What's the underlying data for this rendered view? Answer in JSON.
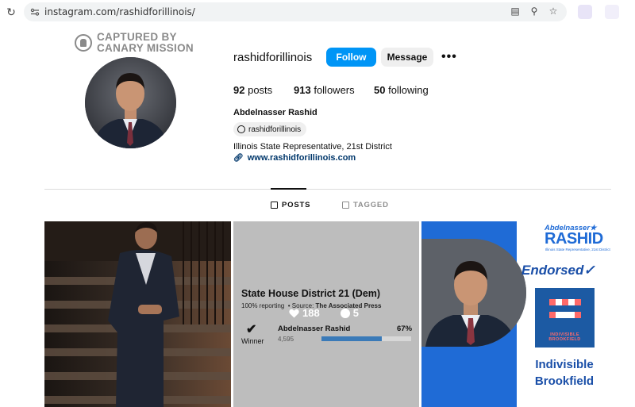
{
  "browser": {
    "url": "instagram.com/rashidforillinois/"
  },
  "watermark": {
    "line1": "CAPTURED BY",
    "line2": "CANARY MISSION"
  },
  "profile": {
    "username": "rashidforillinois",
    "follow_label": "Follow",
    "message_label": "Message",
    "more_label": "•••",
    "stats": {
      "posts_count": "92",
      "posts_label": "posts",
      "followers_count": "913",
      "followers_label": "followers",
      "following_count": "50",
      "following_label": "following"
    },
    "full_name": "Abdelnasser Rashid",
    "threads_handle": "rashidforillinois",
    "bio": "Illinois State Representative, 21st District",
    "website": "www.rashidforillinois.com"
  },
  "tabs": [
    {
      "label": "POSTS",
      "active": true
    },
    {
      "label": "TAGGED",
      "active": false
    }
  ],
  "posts": {
    "post2": {
      "title": "State House District 21 (Dem)",
      "reporting": "100% reporting",
      "source_label": "Source:",
      "source": "The Associated Press",
      "likes": "188",
      "comments": "5",
      "winner_label": "Winner",
      "candidate": "Abdelnasser Rashid",
      "votes": "4,595",
      "percent": "67%",
      "percent_value": 0.67,
      "bar_color": "#3a7ab8"
    },
    "post3": {
      "name_small": "Abdelnasser★",
      "name_big": "RASHID",
      "subtitle": "Illinois State Representative, 21st District",
      "endorsed": "Endorsed",
      "logo_text": "INDIVISIBLE BROOKFIELD",
      "org_line1": "Indivisible",
      "org_line2": "Brookfield"
    }
  },
  "colors": {
    "accent": "#0095f6",
    "link": "#00376b",
    "brand_blue": "#1f6bd6"
  }
}
